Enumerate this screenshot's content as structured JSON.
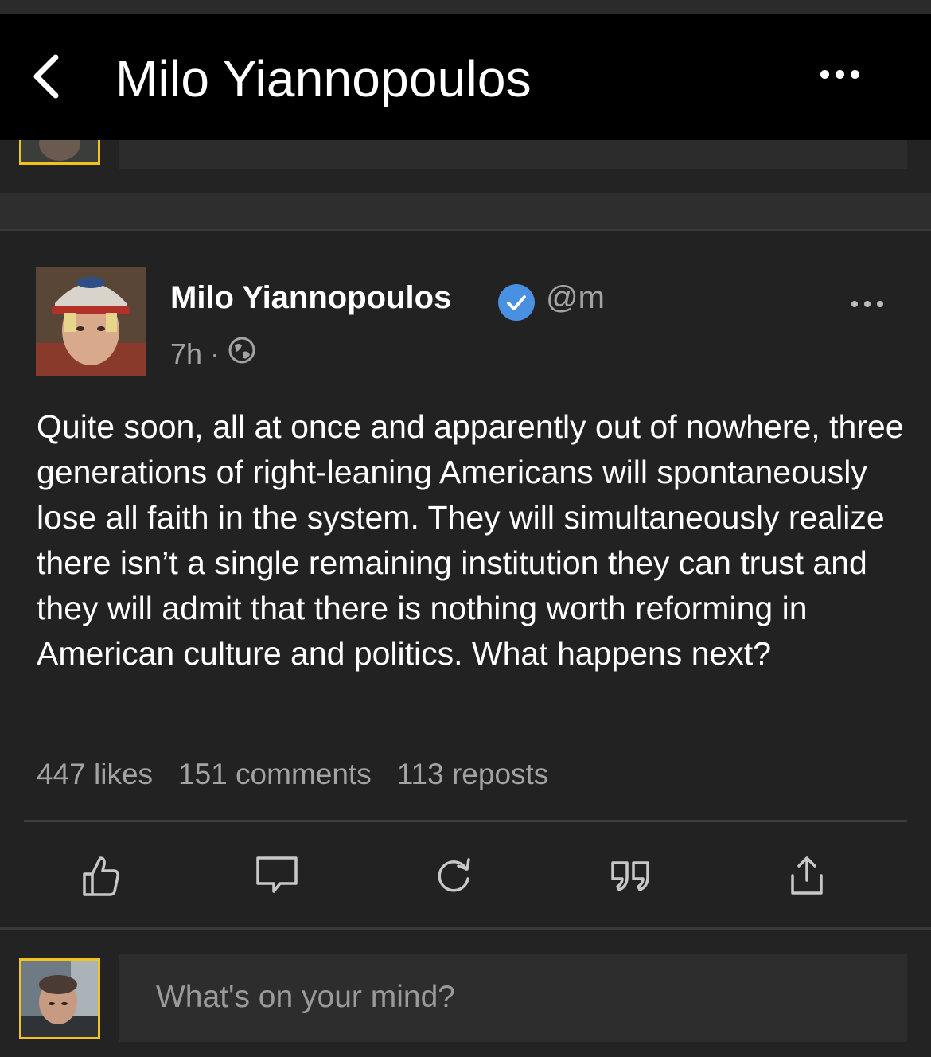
{
  "header": {
    "title": "Milo Yiannopoulos"
  },
  "post": {
    "author": "Milo Yiannopoulos",
    "handle": "@m",
    "time": "7h",
    "dot": "·",
    "text": "Quite soon, all at once and apparently out of nowhere, three generations of right-leaning Americans will spontaneously lose all faith in the system. They will simultaneously realize there isn’t a single remaining institution they can trust and they will admit that there is nothing worth reforming in American culture and politics. What happens next?",
    "stats": {
      "likes": "447 likes",
      "comments": "151 comments",
      "reposts": "113 reposts"
    }
  },
  "composer": {
    "placeholder": "What's on your mind?"
  },
  "colors": {
    "accent_border": "#f2c31c",
    "verified": "#4a90e2"
  }
}
